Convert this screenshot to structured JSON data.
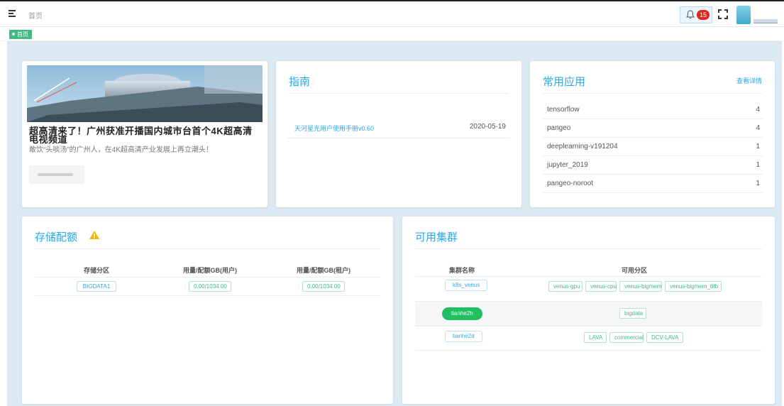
{
  "header": {
    "breadcrumb": "首页",
    "notification_count": "15"
  },
  "tags": {
    "active_tag": "首页"
  },
  "news": {
    "headline": "超高清来了！广州获准开播国内城市台首个4K超高清电视频道",
    "summary": "敢饮“头啖汤”的广州人，在4K超高清产业发展上再立潮头！"
  },
  "guide": {
    "title": "指南",
    "items": [
      {
        "name": "天河星光用户使用手册v0.60",
        "date": "2020-05-19"
      }
    ]
  },
  "apps": {
    "title": "常用应用",
    "detail_link": "查看详情",
    "items": [
      {
        "name": "tensorflow",
        "count": "4"
      },
      {
        "name": "pangeo",
        "count": "4"
      },
      {
        "name": "deeplearning-v191204",
        "count": "1"
      },
      {
        "name": "jupyter_2019",
        "count": "1"
      },
      {
        "name": "pangeo-noroot",
        "count": "1"
      }
    ]
  },
  "storage": {
    "title": "存储配额",
    "columns": [
      "存储分区",
      "用量/配额GB(用户)",
      "用量/配额GB(租户)"
    ],
    "rows": [
      {
        "partition": "BIGDATA1",
        "user_quota": "0.00/1034.00",
        "tenant_quota": "0.00/1034.00"
      }
    ]
  },
  "clusters": {
    "title": "可用集群",
    "columns": [
      "集群名称",
      "可用分区"
    ],
    "rows": [
      {
        "name": "k8s_venus",
        "partitions": [
          "venus-gpu",
          "venus-cpu",
          "venus-bigmem",
          "venus-bigmem_6tb"
        ]
      },
      {
        "name": "tianhe2h",
        "partitions": [
          "bigdata"
        ]
      },
      {
        "name": "tianhe2d",
        "partitions": [
          "LAVA",
          "commercial",
          "DCV-LAVA"
        ]
      }
    ]
  },
  "colors": {
    "accent_blue": "#2ba8e8",
    "accent_green": "#42b983",
    "badge_red": "#e1251b",
    "background": "#dbe9f3"
  },
  "icons": [
    "menu-icon",
    "bell-icon",
    "fullscreen-icon",
    "avatar",
    "warning-icon"
  ]
}
